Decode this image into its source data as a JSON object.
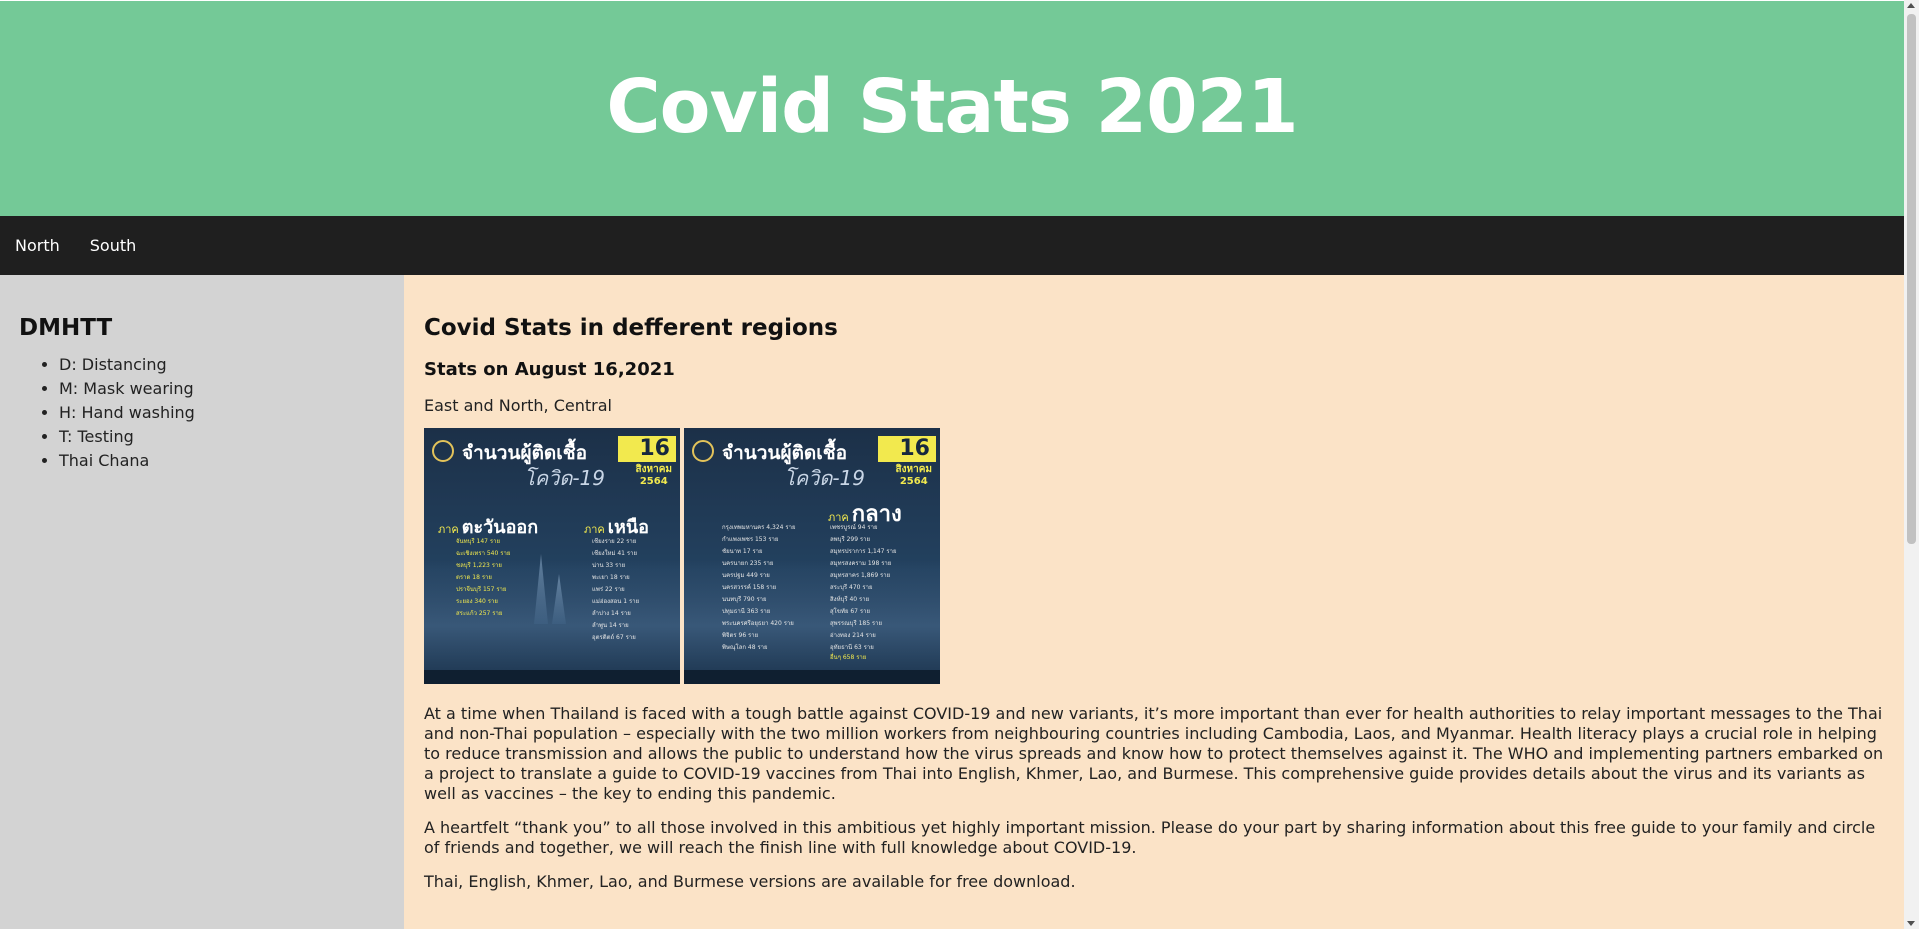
{
  "header": {
    "title": "Covid Stats 2021"
  },
  "nav": {
    "items": [
      {
        "label": "North"
      },
      {
        "label": "South"
      }
    ]
  },
  "sidebar": {
    "title": "DMHTT",
    "items": [
      {
        "label": "D: Distancing"
      },
      {
        "label": "M: Mask wearing"
      },
      {
        "label": "H: Hand washing"
      },
      {
        "label": "T: Testing"
      },
      {
        "label": "Thai Chana"
      }
    ]
  },
  "main": {
    "title": "Covid Stats in defferent regions",
    "subtitle": "Stats on August 16,2021",
    "regions_label": "East and North, Central",
    "posters": [
      {
        "heading": "จำนวนผู้ติดเชื้อ",
        "subheading": "โควิด-19",
        "day": "16",
        "month": "สิงหาคม",
        "year": "2564",
        "region_left_prefix": "ภาค",
        "region_left": "ตะวันออก",
        "region_right_prefix": "ภาค",
        "region_right": "เหนือ",
        "rows_left": [
          "จันทบุรี 147 ราย",
          "ฉะเชิงเทรา 540 ราย",
          "ชลบุรี 1,223 ราย",
          "ตราด 18 ราย",
          "ปราจีนบุรี 157 ราย",
          "ระยอง 340 ราย",
          "สระแก้ว 257 ราย"
        ],
        "rows_right": [
          "เชียงราย 22 ราย",
          "เชียงใหม่ 41 ราย",
          "น่าน 33 ราย",
          "พะเยา 18 ราย",
          "แพร่ 22 ราย",
          "แม่ฮ่องสอน 1 ราย",
          "ลำปาง 14 ราย",
          "ลำพูน 14 ราย",
          "อุตรดิตถ์ 67 ราย"
        ]
      },
      {
        "heading": "จำนวนผู้ติดเชื้อ",
        "subheading": "โควิด-19",
        "day": "16",
        "month": "สิงหาคม",
        "year": "2564",
        "region_prefix": "ภาค",
        "region": "กลาง",
        "rows_left": [
          "กรุงเทพมหานคร 4,324 ราย",
          "กำแพงเพชร 153 ราย",
          "ชัยนาท 17 ราย",
          "นครนายก 235 ราย",
          "นครปฐม 449 ราย",
          "นครสวรรค์ 158 ราย",
          "นนทบุรี 790 ราย",
          "ปทุมธานี 363 ราย",
          "พระนครศรีอยุธยา 420 ราย",
          "พิจิตร 96 ราย",
          "พิษณุโลก 48 ราย"
        ],
        "rows_right": [
          "เพชรบูรณ์ 94 ราย",
          "ลพบุรี 299 ราย",
          "สมุทรปราการ 1,147 ราย",
          "สมุทรสงคราม 198 ราย",
          "สมุทรสาคร 1,869 ราย",
          "สระบุรี 470 ราย",
          "สิงห์บุรี 40 ราย",
          "สุโขทัย 67 ราย",
          "สุพรรณบุรี 185 ราย",
          "อ่างทอง 214 ราย",
          "อุทัยธานี 63 ราย"
        ],
        "footer_row": "อื่นๆ 658 ราย"
      }
    ],
    "paragraphs": [
      "At a time when Thailand is faced with a tough battle against COVID-19 and new variants, it’s more important than ever for health authorities to relay important messages to the Thai and non-Thai population – especially with the two million workers from neighbouring countries including Cambodia, Laos, and Myanmar. Health literacy plays a crucial role in helping to reduce transmission and allows the public to understand how the virus spreads and know how to protect themselves against it. The WHO and implementing partners embarked on a project to translate a guide to COVID-19 vaccines from Thai into English, Khmer, Lao, and Burmese. This comprehensive guide provides details about the virus and its variants as well as vaccines – the key to ending this pandemic.",
      "A heartfelt “thank you” to all those involved in this ambitious yet highly important mission. Please do your part by sharing information about this free guide to your family and circle of friends and together, we will reach the finish line with full knowledge about COVID-19.",
      "Thai, English, Khmer, Lao, and Burmese versions are available for free download."
    ]
  },
  "colors": {
    "header_bg": "#74c997",
    "nav_bg": "#1f1f1f",
    "sidebar_bg": "#d3d3d3",
    "content_bg": "#fbe3c7",
    "poster_accent": "#f2e94e"
  },
  "icons": {
    "scroll_up": "scroll-up-arrow-icon",
    "scroll_down": "scroll-down-arrow-icon"
  }
}
